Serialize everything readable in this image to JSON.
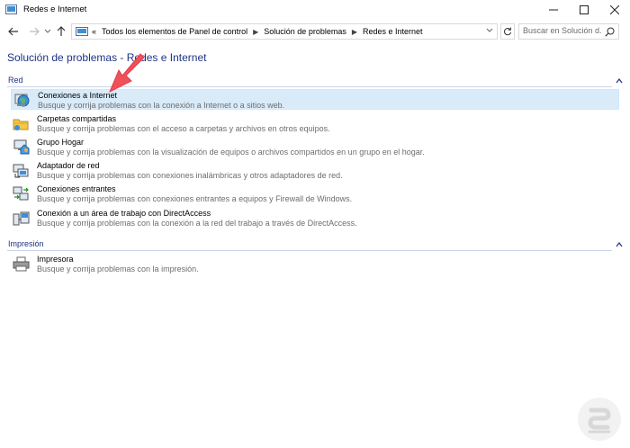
{
  "window": {
    "title": "Redes e Internet"
  },
  "address": {
    "overflow": "«",
    "crumbs": [
      "Todos los elementos de Panel de control",
      "Solución de problemas",
      "Redes e Internet"
    ]
  },
  "search": {
    "placeholder": "Buscar en Solución d..."
  },
  "page": {
    "title": "Solución de problemas - Redes e Internet"
  },
  "sections": [
    {
      "label": "Red",
      "items": [
        {
          "name": "Conexiones a Internet",
          "desc": "Busque y corrija problemas con la conexión a Internet o a sitios web.",
          "icon": "internet-globe-icon",
          "selected": true
        },
        {
          "name": "Carpetas compartidas",
          "desc": "Busque y corrija problemas con el acceso a carpetas y archivos en otros equipos.",
          "icon": "shared-folder-icon"
        },
        {
          "name": "Grupo Hogar",
          "desc": "Busque y corrija problemas con la visualización de equipos o archivos compartidos en un grupo en el hogar.",
          "icon": "homegroup-icon"
        },
        {
          "name": "Adaptador de red",
          "desc": "Busque y corrija problemas con conexiones inalámbricas y otros adaptadores de red.",
          "icon": "network-adapter-icon"
        },
        {
          "name": "Conexiones entrantes",
          "desc": "Busque y corrija problemas con conexiones entrantes a equipos y Firewall de Windows.",
          "icon": "incoming-connections-icon"
        },
        {
          "name": "Conexión a un área de trabajo con DirectAccess",
          "desc": "Busque y corrija problemas con la conexión a la red del trabajo a través de DirectAccess.",
          "icon": "directaccess-icon"
        }
      ]
    },
    {
      "label": "Impresión",
      "items": [
        {
          "name": "Impresora",
          "desc": "Busque y corrija problemas con la impresión.",
          "icon": "printer-icon"
        }
      ]
    }
  ],
  "colors": {
    "accent": "#1e3287",
    "selected_bg": "#d9ebf9",
    "annotation_arrow": "#f0505a"
  }
}
